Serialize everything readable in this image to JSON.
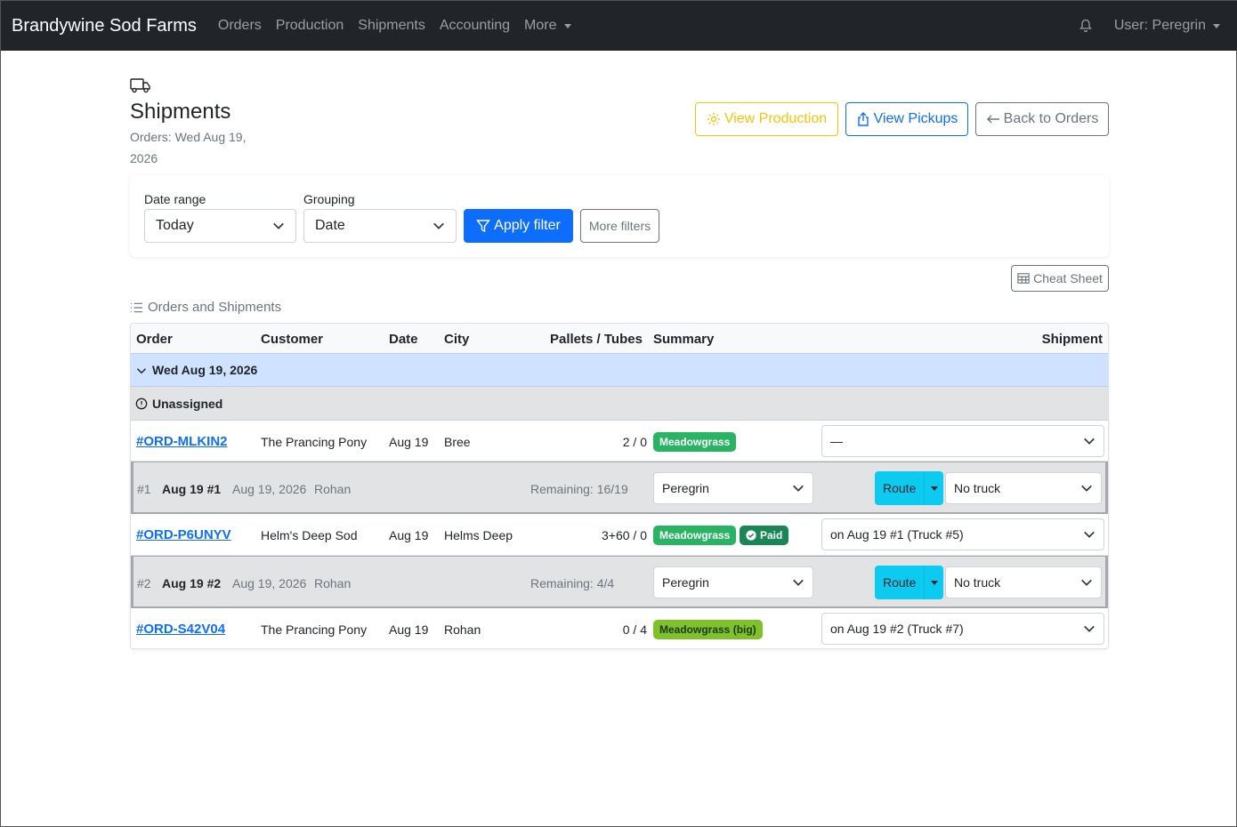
{
  "navbar": {
    "brand": "Brandywine Sod Farms",
    "links": [
      "Orders",
      "Production",
      "Shipments",
      "Accounting",
      "More"
    ],
    "user": "User: Peregrin"
  },
  "header": {
    "title": "Shipments",
    "subtitle": "Orders: Wed Aug 19, 2026",
    "view_production": "View Production",
    "view_pickups": "View Pickups",
    "back_to_orders": "Back to Orders"
  },
  "filters": {
    "date_range_label": "Date range",
    "date_range_value": "Today",
    "grouping_label": "Grouping",
    "grouping_value": "Date",
    "apply": "Apply filter",
    "more": "More filters"
  },
  "cheat_sheet": "Cheat Sheet",
  "section_title": "Orders and Shipments",
  "table": {
    "headers": [
      "Order",
      "Customer",
      "Date",
      "City",
      "Pallets / Tubes",
      "Summary",
      "Shipment"
    ],
    "group": "Wed Aug 19, 2026",
    "unassigned": "Unassigned",
    "orders": [
      {
        "id": "#ORD-MLKIN2",
        "customer": "The Prancing Pony",
        "date": "Aug 19",
        "city": "Bree",
        "pallets": "2 / 0",
        "badges": [
          "Meadowgrass"
        ],
        "shipment": "—"
      },
      {
        "id": "#ORD-P6UNYV",
        "customer": "Helm's Deep Sod",
        "date": "Aug 19",
        "city": "Helms Deep",
        "pallets": "3+60 / 0",
        "badges": [
          "Meadowgrass",
          "Paid"
        ],
        "shipment": "on Aug 19 #1 (Truck #5)"
      },
      {
        "id": "#ORD-S42V04",
        "customer": "The Prancing Pony",
        "date": "Aug 19",
        "city": "Rohan",
        "pallets": "0 / 4",
        "badges": [
          "Meadowgrass (big)"
        ],
        "shipment": "on Aug 19 #2 (Truck #7)"
      }
    ],
    "shipments": [
      {
        "num": "#1",
        "name": "Aug 19 #1",
        "date": "Aug 19, 2026",
        "place": "Rohan",
        "remaining": "Remaining: 16/19",
        "driver": "Peregrin",
        "route": "Route",
        "truck": "No truck"
      },
      {
        "num": "#2",
        "name": "Aug 19 #2",
        "date": "Aug 19, 2026",
        "place": "Rohan",
        "remaining": "Remaining: 4/4",
        "driver": "Peregrin",
        "route": "Route",
        "truck": "No truck"
      }
    ]
  },
  "colors": {
    "navbar": "#212529",
    "primary": "#0d6efd",
    "warning": "#ffc107",
    "info": "#0dcaf0",
    "success": "#28b463"
  }
}
